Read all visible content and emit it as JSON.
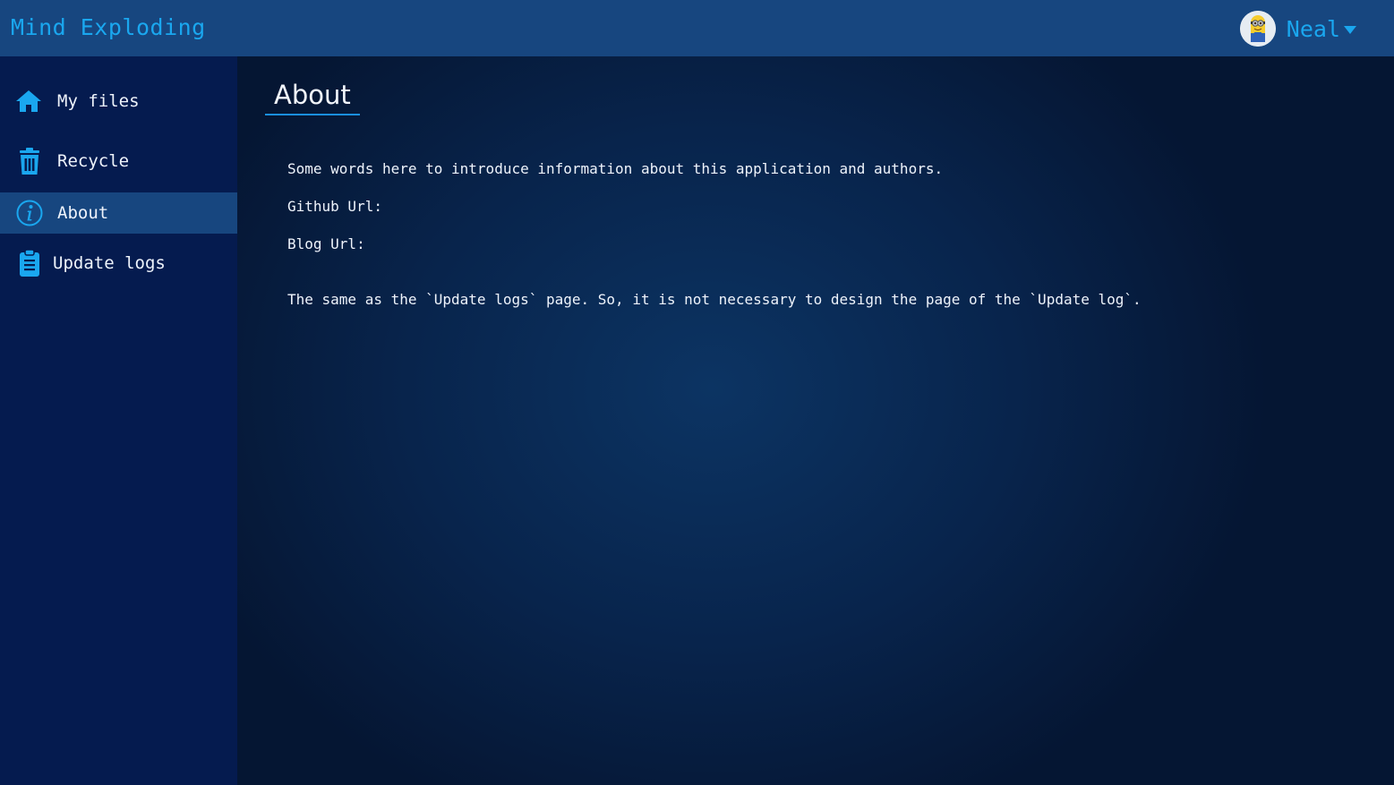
{
  "header": {
    "brand": "Mind Exploding",
    "user": {
      "name": "Neal",
      "avatar_icon": "minion-avatar"
    }
  },
  "sidebar": {
    "items": [
      {
        "label": "My files",
        "icon": "home-icon",
        "active": false
      },
      {
        "label": "Recycle",
        "icon": "trash-icon",
        "active": false
      },
      {
        "label": "About",
        "icon": "info-icon",
        "active": true
      },
      {
        "label": "Update logs",
        "icon": "clipboard-icon",
        "active": false
      }
    ]
  },
  "main": {
    "title": "About",
    "intro": "Some words here to introduce information about this application and authors.",
    "github_label": "Github Url:",
    "blog_label": "Blog Url:",
    "note": "The same as the `Update logs` page. So, it is not necessary to design the page of the `Update log`."
  },
  "colors": {
    "header_bg": "#17467f",
    "sidebar_bg": "#051b4f",
    "accent": "#1aa7ef"
  }
}
